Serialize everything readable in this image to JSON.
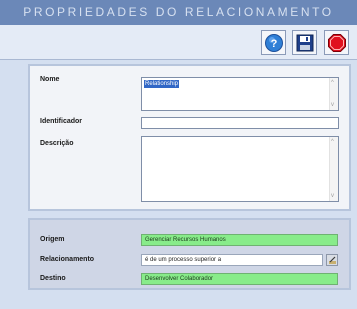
{
  "window": {
    "title": "PROPRIEDADES DO RELACIONAMENTO"
  },
  "toolbar": {
    "help_icon": "help-icon",
    "save_icon": "save-icon",
    "close_icon": "stop-icon"
  },
  "form": {
    "nome_label": "Nome",
    "nome_value": "Relationship",
    "identificador_label": "Identificador",
    "identificador_value": "",
    "descricao_label": "Descrição",
    "descricao_value": ""
  },
  "relation": {
    "origem_label": "Origem",
    "origem_value": "Gerenciar Recursos Humanos",
    "relacionamento_label": "Relacionamento",
    "relacionamento_value": "é de um processo superior a",
    "destino_label": "Destino",
    "destino_value": "Desenvolver Colaborador"
  },
  "colors": {
    "titlebar": "#6b88b8",
    "highlight_field": "#88ec8a",
    "selection": "#3167c6",
    "stop": "#e0101e"
  }
}
